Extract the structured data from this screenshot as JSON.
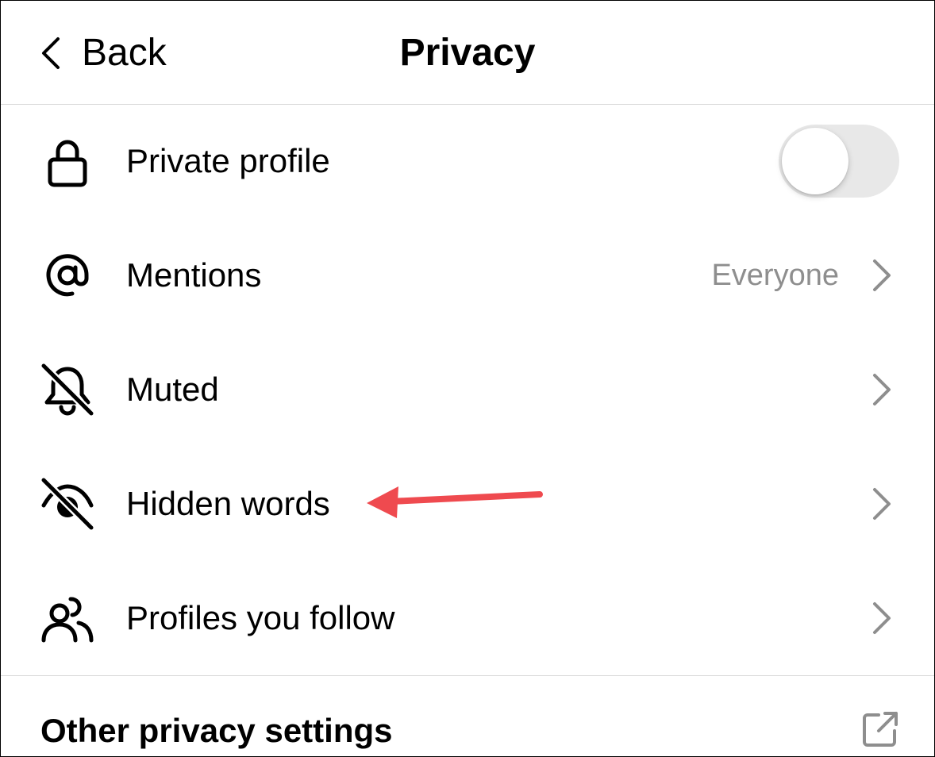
{
  "header": {
    "back_label": "Back",
    "title": "Privacy"
  },
  "rows": [
    {
      "label": "Private profile",
      "icon": "lock-icon",
      "control": "toggle",
      "toggle_on": false
    },
    {
      "label": "Mentions",
      "icon": "at-sign-icon",
      "value": "Everyone",
      "control": "chevron"
    },
    {
      "label": "Muted",
      "icon": "bell-muted-icon",
      "control": "chevron"
    },
    {
      "label": "Hidden words",
      "icon": "eye-slash-icon",
      "control": "chevron"
    },
    {
      "label": "Profiles you follow",
      "icon": "people-icon",
      "control": "chevron"
    }
  ],
  "other": {
    "label": "Other privacy settings",
    "icon": "external-link-icon"
  },
  "colors": {
    "text": "#000000",
    "secondary_text": "#8e8e8e",
    "chevron": "#8e8e8e",
    "toggle_off_track": "#e8e8e8",
    "divider": "#d9d9d9",
    "annotation_arrow": "#ef4a4f"
  }
}
